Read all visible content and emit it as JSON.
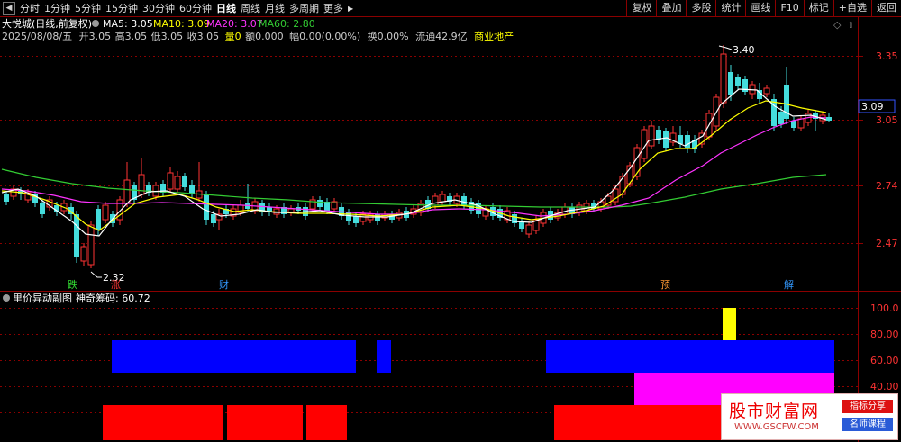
{
  "toolbar": {
    "left_items": [
      "分时",
      "1分钟",
      "5分钟",
      "15分钟",
      "30分钟",
      "60分钟",
      "日线",
      "周线",
      "月线",
      "多周期",
      "更多"
    ],
    "active_item": "日线",
    "right_buttons": [
      "复权",
      "叠加",
      "多股",
      "统计",
      "画线",
      "F10",
      "标记",
      "+自选",
      "返回"
    ]
  },
  "main_panel": {
    "stock_name": "大悦城(日线,前复权)",
    "ma_legend": [
      {
        "label": "MA5: 3.05",
        "color": "#ffffff"
      },
      {
        "label": "MA10: 3.09",
        "color": "#ffff00"
      },
      {
        "label": "MA20: 3.07",
        "color": "#ff33ff"
      },
      {
        "label": "MA60: 2.80",
        "color": "#33cc33"
      }
    ],
    "info_line": [
      {
        "text": "2025/08/08/五",
        "color": "#cccccc"
      },
      {
        "text": "开3.05",
        "color": "#cccccc"
      },
      {
        "text": "高3.05",
        "color": "#cccccc"
      },
      {
        "text": "低3.05",
        "color": "#cccccc"
      },
      {
        "text": "收3.05",
        "color": "#cccccc"
      },
      {
        "text": "量0",
        "color": "#ffff00"
      },
      {
        "text": "额0.000",
        "color": "#cccccc"
      },
      {
        "text": "幅0.00(0.00%)",
        "color": "#cccccc"
      },
      {
        "text": "换0.00%",
        "color": "#cccccc"
      },
      {
        "text": "流通42.9亿",
        "color": "#cccccc"
      },
      {
        "text": "商业地产",
        "color": "#ffff00"
      }
    ],
    "price_axis_labels": [
      "3.35",
      "3.05",
      "2.74",
      "2.47"
    ],
    "current_price": "3.09",
    "high_marker": "3.40",
    "low_marker": "2.32",
    "event_markers": [
      "跌",
      "涨",
      "财",
      "预",
      "解"
    ]
  },
  "sub_panel": {
    "title": "里价异动副图",
    "indicator": "神奇筹码: 60.72",
    "axis_labels": [
      "100.0",
      "80.00",
      "60.00",
      "40.00"
    ]
  },
  "watermark": {
    "title": "股市财富网",
    "url": "WWW.GSCFW.COM",
    "tag1": "指标分享",
    "tag2": "名师课程"
  },
  "colors": {
    "up": "#ff3333",
    "down": "#44dddd",
    "ma5": "#ffffff",
    "ma10": "#ffff00",
    "ma20": "#ff33ff",
    "ma60": "#33cc33",
    "bar_blue": "#0000ff",
    "bar_red": "#ff0000",
    "bar_magenta": "#ff00ff",
    "bar_yellow": "#ffff00"
  }
}
